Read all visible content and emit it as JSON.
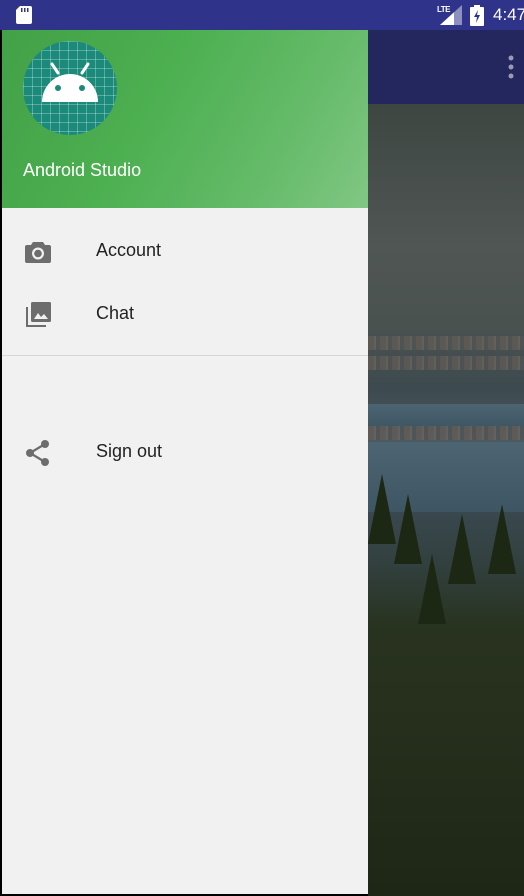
{
  "status_bar": {
    "network": "LTE",
    "time": "4:47"
  },
  "drawer": {
    "header": {
      "name": "Android Studio"
    },
    "items": [
      {
        "label": "Account",
        "icon": "camera-icon"
      },
      {
        "label": "Chat",
        "icon": "photo-library-icon"
      }
    ],
    "secondary_items": [
      {
        "label": "Sign out",
        "icon": "share-icon"
      }
    ]
  },
  "colors": {
    "status_bar": "#2f348a",
    "header_green": "#4caf50",
    "drawer_bg": "#f1f1f1"
  }
}
